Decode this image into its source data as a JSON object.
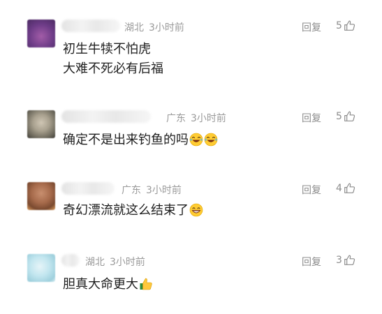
{
  "comments": [
    {
      "location": "湖北",
      "time": "3小时前",
      "reply_label": "回复",
      "likes": "5",
      "lines": [
        "初生牛犊不怕虎",
        "大难不死必有后福"
      ],
      "emoji_icons": []
    },
    {
      "location": "广东",
      "time": "3小时前",
      "reply_label": "回复",
      "likes": "5",
      "lines": [
        "确定不是出来钓鱼的吗"
      ],
      "emoji_icons": [
        "laugh-cry-emoji",
        "laugh-cry-emoji"
      ]
    },
    {
      "location": "广东",
      "time": "3小时前",
      "reply_label": "回复",
      "likes": "4",
      "lines": [
        "奇幻漂流就这么结束了"
      ],
      "emoji_icons": [
        "grin-emoji"
      ]
    },
    {
      "location": "湖北",
      "time": "3小时前",
      "reply_label": "回复",
      "likes": "3",
      "lines": [
        "胆真大命更大"
      ],
      "emoji_icons": [
        "thumbs-up-emoji"
      ]
    }
  ],
  "colors": {
    "meta_text": "#9a9a9a",
    "body_text": "#1e1e1e",
    "reply_text": "#8c8c8c"
  }
}
